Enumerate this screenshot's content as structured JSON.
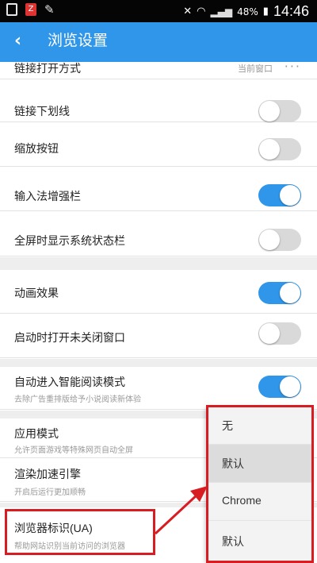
{
  "status_bar": {
    "left_icons": [
      "picture-icon",
      "app-z-icon",
      "pen-icon"
    ],
    "signal_text": "4G",
    "battery": "48%",
    "time": "14:46"
  },
  "header": {
    "back_glyph": "‹",
    "title": "浏览设置"
  },
  "settings": {
    "link_open": {
      "label": "链接打开方式",
      "value": "当前窗口",
      "more": "···"
    },
    "link_underline": {
      "label": "链接下划线",
      "enabled": false
    },
    "zoom_buttons": {
      "label": "缩放按钮",
      "enabled": false
    },
    "ime_bar": {
      "label": "输入法增强栏",
      "enabled": true
    },
    "fullscreen_status": {
      "label": "全屏时显示系统状态栏",
      "enabled": false
    },
    "animation": {
      "label": "动画效果",
      "enabled": true
    },
    "restore_windows": {
      "label": "启动时打开未关闭窗口",
      "enabled": false
    },
    "smart_read": {
      "label": "自动进入智能阅读模式",
      "sub": "去除广告重排版给予小说阅读新体验",
      "enabled": true
    },
    "app_mode": {
      "label": "应用模式",
      "sub": "允许页面游戏等特殊网页自动全屏"
    },
    "render_accel": {
      "label": "渲染加速引擎",
      "sub": "开启后运行更加顺畅"
    },
    "user_agent": {
      "label": "浏览器标识(UA)",
      "sub": "帮助网站识别当前访问的浏览器"
    }
  },
  "ua_dropdown": {
    "options": [
      "无",
      "默认",
      "Chrome",
      "默认"
    ],
    "selected_index": 1
  },
  "colors": {
    "accent": "#2f96ea",
    "annotation": "#d81d22"
  }
}
